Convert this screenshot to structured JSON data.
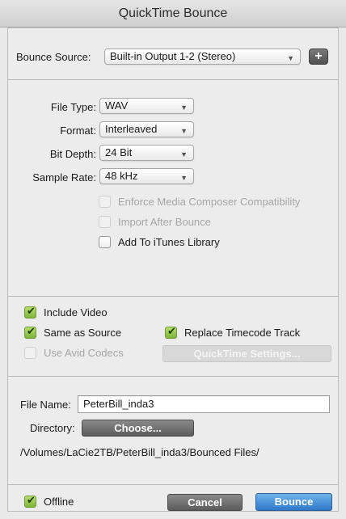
{
  "window": {
    "title": "QuickTime Bounce"
  },
  "bounce_source": {
    "label": "Bounce Source:",
    "value": "Built-in Output 1-2 (Stereo)",
    "add_button_label": "+"
  },
  "audio": {
    "file_type": {
      "label": "File Type:",
      "value": "WAV"
    },
    "format": {
      "label": "Format:",
      "value": "Interleaved"
    },
    "bit_depth": {
      "label": "Bit Depth:",
      "value": "24 Bit"
    },
    "sample_rate": {
      "label": "Sample Rate:",
      "value": "48 kHz"
    },
    "enforce_compat": {
      "label": "Enforce Media Composer Compatibility",
      "checked": false,
      "enabled": false
    },
    "import_after": {
      "label": "Import After Bounce",
      "checked": false,
      "enabled": false
    },
    "add_itunes": {
      "label": "Add To iTunes Library",
      "checked": false,
      "enabled": true
    }
  },
  "video": {
    "include_video": {
      "label": "Include Video",
      "checked": true
    },
    "same_as_source": {
      "label": "Same as Source",
      "checked": true
    },
    "replace_timecode": {
      "label": "Replace Timecode Track",
      "checked": true
    },
    "use_avid_codecs": {
      "label": "Use Avid Codecs",
      "checked": false,
      "enabled": false
    },
    "qt_settings_label": "QuickTime Settings..."
  },
  "file": {
    "name_label": "File Name:",
    "name_value": "PeterBill_inda3",
    "directory_label": "Directory:",
    "choose_label": "Choose...",
    "path": "/Volumes/LaCie2TB/PeterBill_inda3/Bounced Files/"
  },
  "footer": {
    "offline": {
      "label": "Offline",
      "checked": true
    },
    "cancel_label": "Cancel",
    "bounce_label": "Bounce"
  },
  "colors": {
    "check_green": "#8cc044",
    "bounce_blue": "#3f8ad8",
    "dark_button": "#6a6a6a"
  }
}
